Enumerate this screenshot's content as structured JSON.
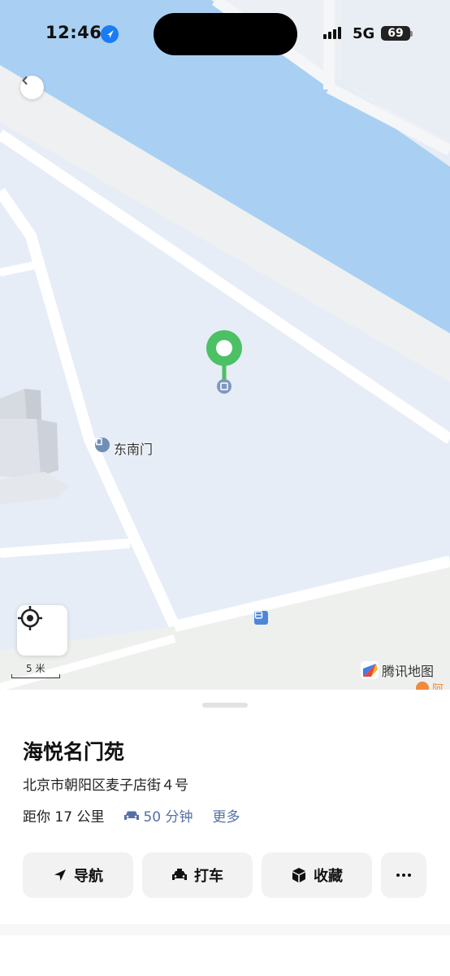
{
  "status_bar": {
    "time": "12:46",
    "network": "5G",
    "battery": "69"
  },
  "map": {
    "poi_label": "东南门",
    "scale_label": "5 米",
    "brand_label": "腾讯地图",
    "edge_poi_label": "阿",
    "colors": {
      "water": "#a9d0f2",
      "land": "#e8eef7",
      "road": "#ffffff",
      "pin": "#4cc064"
    }
  },
  "place": {
    "name": "海悦名门苑",
    "address": "北京市朝阳区麦子店街４号",
    "distance": "距你 17 公里",
    "drive_time": "50 分钟",
    "more_label": "更多"
  },
  "actions": {
    "navigate": "导航",
    "taxi": "打车",
    "favorite": "收藏",
    "more_icon": "ellipsis-icon"
  }
}
